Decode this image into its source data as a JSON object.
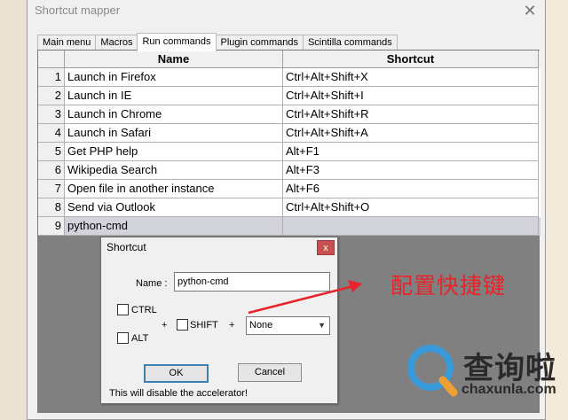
{
  "window": {
    "title": "Shortcut mapper",
    "close_glyph": "✕"
  },
  "tabs": [
    {
      "label": "Main menu",
      "active": false
    },
    {
      "label": "Macros",
      "active": false
    },
    {
      "label": "Run commands",
      "active": true
    },
    {
      "label": "Plugin commands",
      "active": false
    },
    {
      "label": "Scintilla commands",
      "active": false
    }
  ],
  "grid": {
    "headers": {
      "name": "Name",
      "shortcut": "Shortcut"
    },
    "rows": [
      {
        "num": "1",
        "name": "Launch in Firefox",
        "shortcut": "Ctrl+Alt+Shift+X"
      },
      {
        "num": "2",
        "name": "Launch in IE",
        "shortcut": "Ctrl+Alt+Shift+I"
      },
      {
        "num": "3",
        "name": "Launch in Chrome",
        "shortcut": "Ctrl+Alt+Shift+R"
      },
      {
        "num": "4",
        "name": "Launch in Safari",
        "shortcut": "Ctrl+Alt+Shift+A"
      },
      {
        "num": "5",
        "name": "Get PHP help",
        "shortcut": "Alt+F1"
      },
      {
        "num": "6",
        "name": "Wikipedia Search",
        "shortcut": "Alt+F3"
      },
      {
        "num": "7",
        "name": "Open file in another instance",
        "shortcut": "Alt+F6"
      },
      {
        "num": "8",
        "name": "Send via Outlook",
        "shortcut": "Ctrl+Alt+Shift+O"
      },
      {
        "num": "9",
        "name": "python-cmd",
        "shortcut": ""
      }
    ]
  },
  "shortcut_dialog": {
    "title": "Shortcut",
    "close_glyph": "x",
    "name_label": "Name :",
    "name_value": "python-cmd",
    "ctrl_label": "CTRL",
    "alt_label": "ALT",
    "shift_label": "SHIFT",
    "plus1": "+",
    "plus2": "+",
    "key_value": "None",
    "ok_label": "OK",
    "cancel_label": "Cancel",
    "note": "This will disable the accelerator!"
  },
  "annotation": {
    "text": "配置快捷键",
    "color": "#e8242a"
  },
  "watermark": {
    "text": "查询啦",
    "url": "chaxunla.com"
  }
}
